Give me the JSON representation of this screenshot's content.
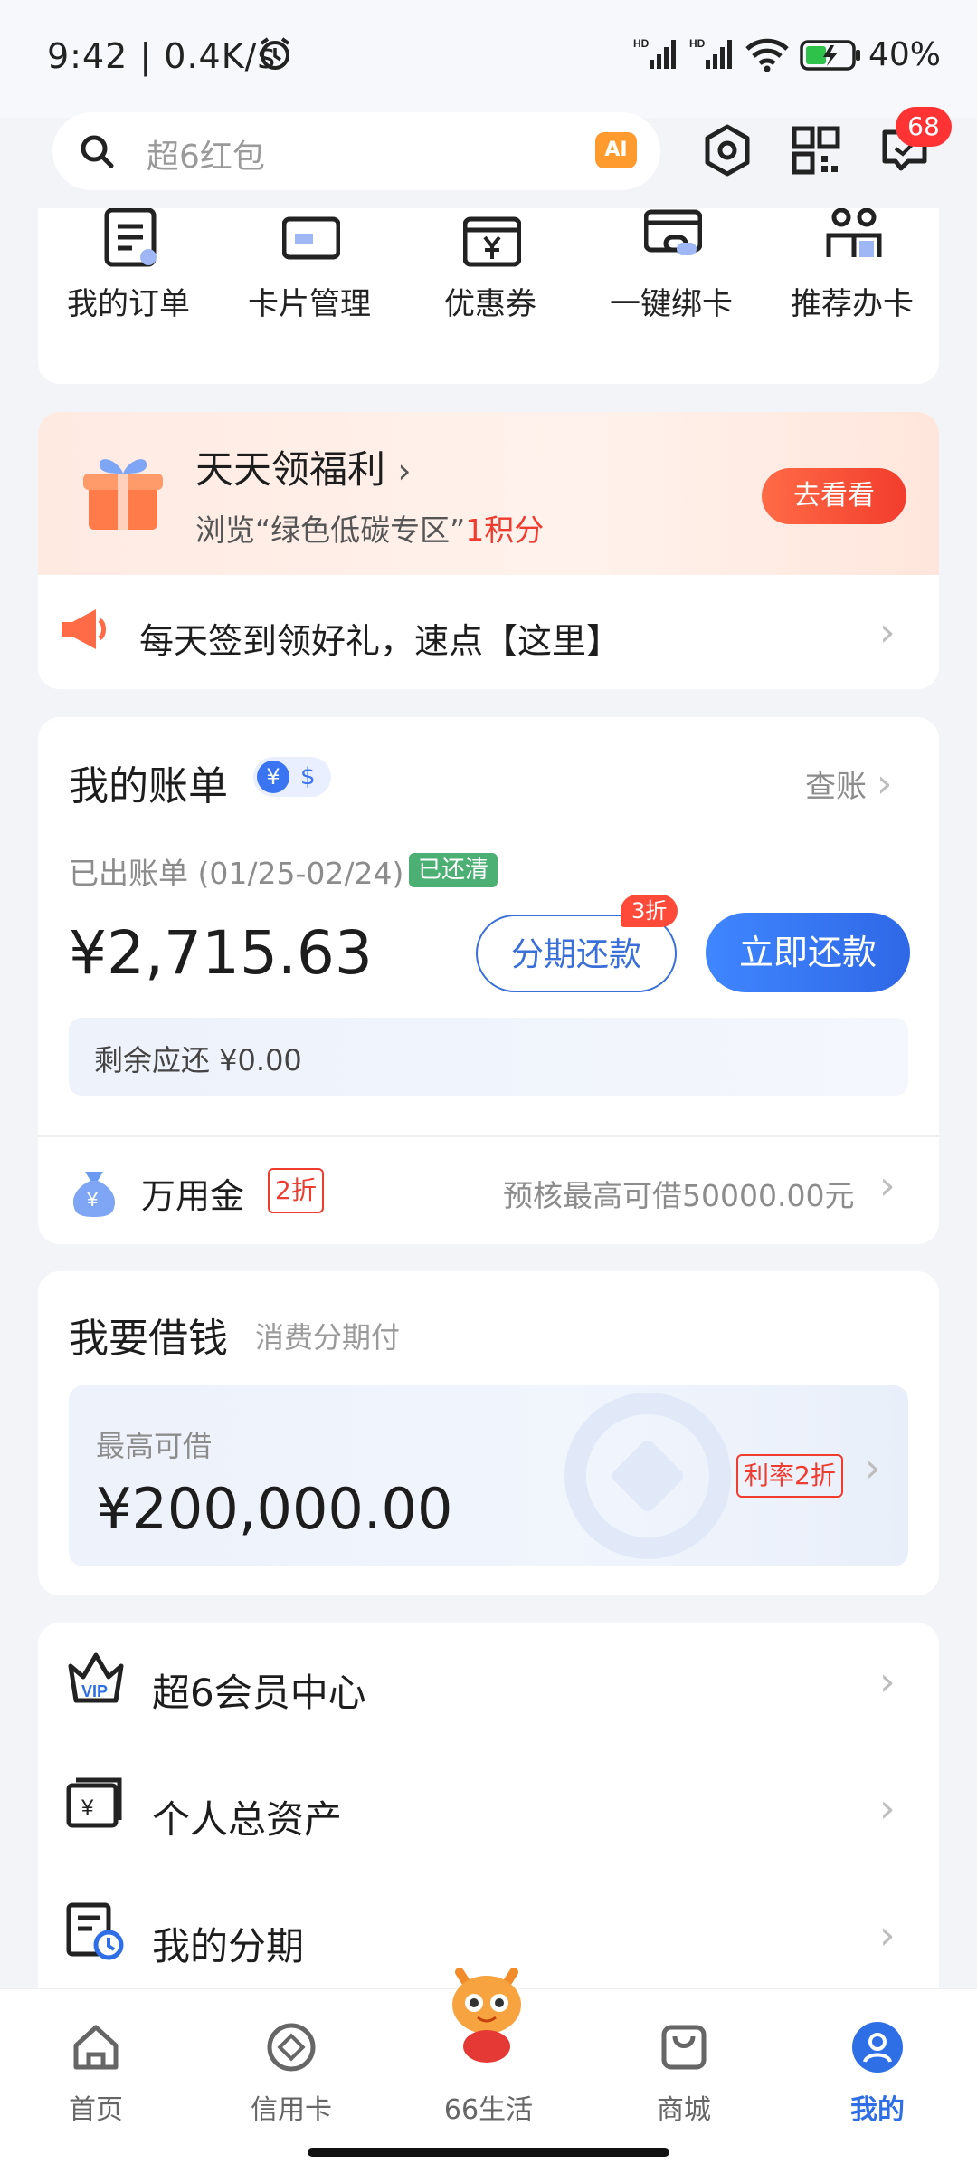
{
  "status_bar": {
    "time": "9:42 | 0.4K/s",
    "battery": "40%",
    "signal1": "HD",
    "signal2": "HD"
  },
  "search": {
    "placeholder": "超6红包",
    "ai_label": "AI"
  },
  "header": {
    "message_badge": "68"
  },
  "quick_menu": [
    {
      "label": "我的订单",
      "icon": "order-icon"
    },
    {
      "label": "卡片管理",
      "icon": "card-icon"
    },
    {
      "label": "优惠券",
      "icon": "coupon-icon"
    },
    {
      "label": "一键绑卡",
      "icon": "bind-card-icon"
    },
    {
      "label": "推荐办卡",
      "icon": "recommend-icon"
    }
  ],
  "welfare": {
    "title": "天天领福利",
    "sub_prefix": "浏览“绿色低碳专区”",
    "sub_points": "1积分",
    "button": "去看看",
    "signin": "每天签到领好礼，速点【这里】"
  },
  "bill": {
    "title": "我的账单",
    "currency_rmb": "¥",
    "currency_usd": "$",
    "check_link": "查账",
    "period": "已出账单 (01/25-02/24)",
    "status": "已还清",
    "amount": "¥2,715.63",
    "installment_button": "分期还款",
    "installment_tag": "3折",
    "pay_button": "立即还款",
    "remaining": "剩余应还 ¥0.00",
    "wanyongjin": "万用金",
    "wanyongjin_tag": "2折",
    "precheck": "预核最高可借50000.00元"
  },
  "borrow": {
    "title": "我要借钱",
    "subtitle": "消费分期付",
    "max_label": "最高可借",
    "max_amount": "¥200,000.00",
    "rate_tag": "利率2折"
  },
  "menu": [
    {
      "label": "超6会员中心"
    },
    {
      "label": "个人总资产"
    },
    {
      "label": "我的分期"
    }
  ],
  "tabbar": [
    {
      "label": "首页"
    },
    {
      "label": "信用卡"
    },
    {
      "label": "66生活"
    },
    {
      "label": "商城"
    },
    {
      "label": "我的"
    }
  ],
  "colors": {
    "accent_blue": "#2f6fe6",
    "accent_red": "#f03b2f",
    "paid_green": "#4caf73"
  }
}
